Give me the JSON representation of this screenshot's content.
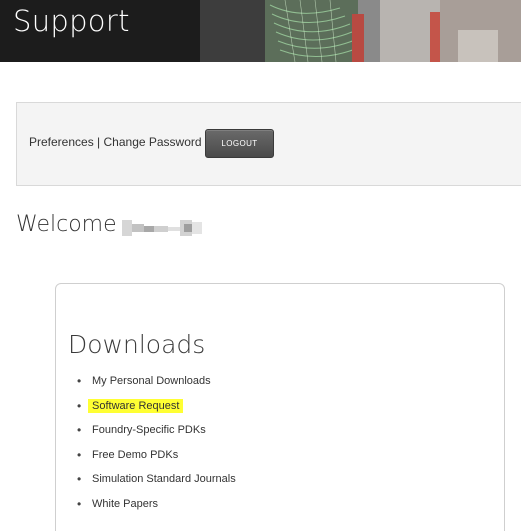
{
  "banner": {
    "title": "Support"
  },
  "account": {
    "preferences_label": "Preferences",
    "separator": " | ",
    "change_password_label": "Change Password",
    "logout_label": "LOGOUT"
  },
  "welcome": {
    "greeting": "Welcome"
  },
  "downloads": {
    "title": "Downloads",
    "items": [
      {
        "label": "My Personal Downloads",
        "highlighted": false
      },
      {
        "label": "Software Request",
        "highlighted": true
      },
      {
        "label": "Foundry-Specific PDKs",
        "highlighted": false
      },
      {
        "label": "Free Demo PDKs",
        "highlighted": false
      },
      {
        "label": "Simulation Standard Journals",
        "highlighted": false
      },
      {
        "label": "White Papers",
        "highlighted": false
      }
    ],
    "highlight_color": "#ffff33"
  },
  "colors": {
    "logout_button": "#555555",
    "panel_background": "#f4f4f4",
    "text": "#333333"
  }
}
